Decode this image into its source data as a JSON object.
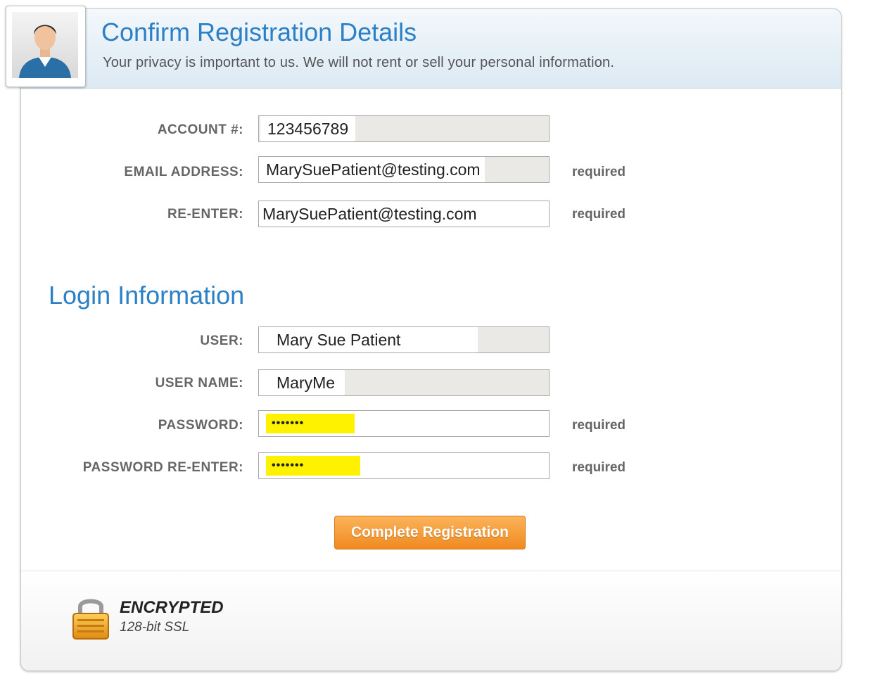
{
  "header": {
    "title": "Confirm Registration Details",
    "subtitle": "Your privacy is important to us. We will not rent or sell your personal information."
  },
  "account": {
    "account_label": "ACCOUNT #:",
    "account_value": "123456789",
    "email_label": "EMAIL ADDRESS:",
    "email_value": "MarySuePatient@testing.com",
    "reenter_label": "RE-ENTER:",
    "reenter_value": "MarySuePatient@testing.com"
  },
  "login": {
    "heading": "Login Information",
    "user_label": "USER:",
    "user_value": "Mary Sue Patient",
    "username_label": "USER NAME:",
    "username_value": "MaryMe",
    "password_label": "PASSWORD:",
    "password_value": "•••••••",
    "password_reenter_label": "PASSWORD RE-ENTER:",
    "password_reenter_value": "•••••••"
  },
  "required_text": "required",
  "actions": {
    "submit_label": "Complete Registration"
  },
  "security": {
    "title": "ENCRYPTED",
    "subtitle": "128-bit SSL"
  },
  "colors": {
    "heading_blue": "#2b80c6",
    "button_orange": "#f5a03a",
    "highlight_yellow": "#fff200",
    "readonly_gray": "#ebe9e5"
  },
  "icons": {
    "avatar": "user-avatar-icon",
    "lock": "padlock-icon"
  }
}
